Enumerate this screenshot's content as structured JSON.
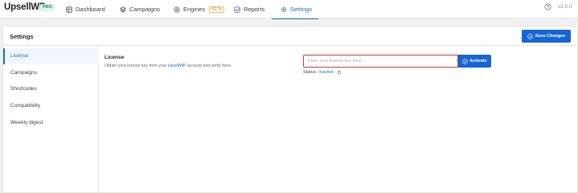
{
  "header": {
    "brand": "UpsellWP",
    "brand_badge": "PRO",
    "nav": [
      {
        "label": "Dashboard",
        "icon": "dashboard-icon"
      },
      {
        "label": "Campaigns",
        "icon": "campaigns-icon"
      },
      {
        "label": "Engines",
        "icon": "engines-icon",
        "badge": "BETA"
      },
      {
        "label": "Reports",
        "icon": "reports-icon"
      },
      {
        "label": "Settings",
        "icon": "gear-icon",
        "active": true
      }
    ],
    "version": "v2.0.0",
    "help_icon": "help-icon"
  },
  "panel": {
    "title": "Settings",
    "save_label": "Save Changes"
  },
  "sidebar": {
    "items": [
      {
        "label": "License",
        "active": true
      },
      {
        "label": "Campaigns"
      },
      {
        "label": "Shortcodes"
      },
      {
        "label": "Compatibility"
      },
      {
        "label": "Weekly digest"
      }
    ]
  },
  "license": {
    "title": "License",
    "desc_prefix": "Obtain your license key from your ",
    "desc_link": "UpsellWP",
    "desc_suffix": " account and verify here.",
    "placeholder": "Enter your license key here...",
    "value": "",
    "activate_label": "Activate",
    "status_label": "Status:",
    "status_value": "Inactive"
  },
  "colors": {
    "accent": "#1565d8",
    "active_nav": "#2271b1",
    "error_border": "#d63638",
    "pro_badge": "#1b8a4a",
    "beta_badge": "#d08a2a"
  }
}
